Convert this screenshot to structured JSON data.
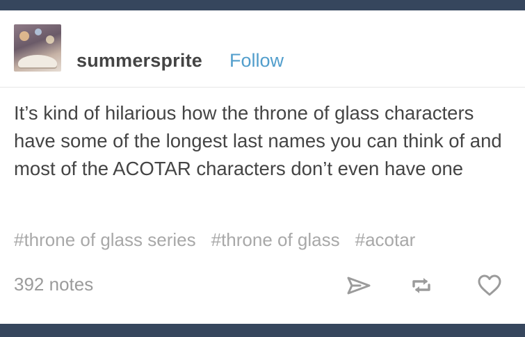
{
  "post": {
    "author": "summersprite",
    "follow_label": "Follow",
    "body": "It’s kind of hilarious how the throne of glass characters have some of the longest last names you can think of and most of the ACOTAR characters don’t even have one",
    "tags": [
      "#throne of glass series",
      "#throne of glass",
      "#acotar"
    ],
    "notes": "392 notes"
  },
  "colors": {
    "frame": "#36465d",
    "link": "#529ecc",
    "text": "#444444",
    "muted": "#a8a8a8"
  },
  "icons": {
    "share": "paper-plane-icon",
    "reblog": "reblog-icon",
    "like": "heart-icon"
  }
}
